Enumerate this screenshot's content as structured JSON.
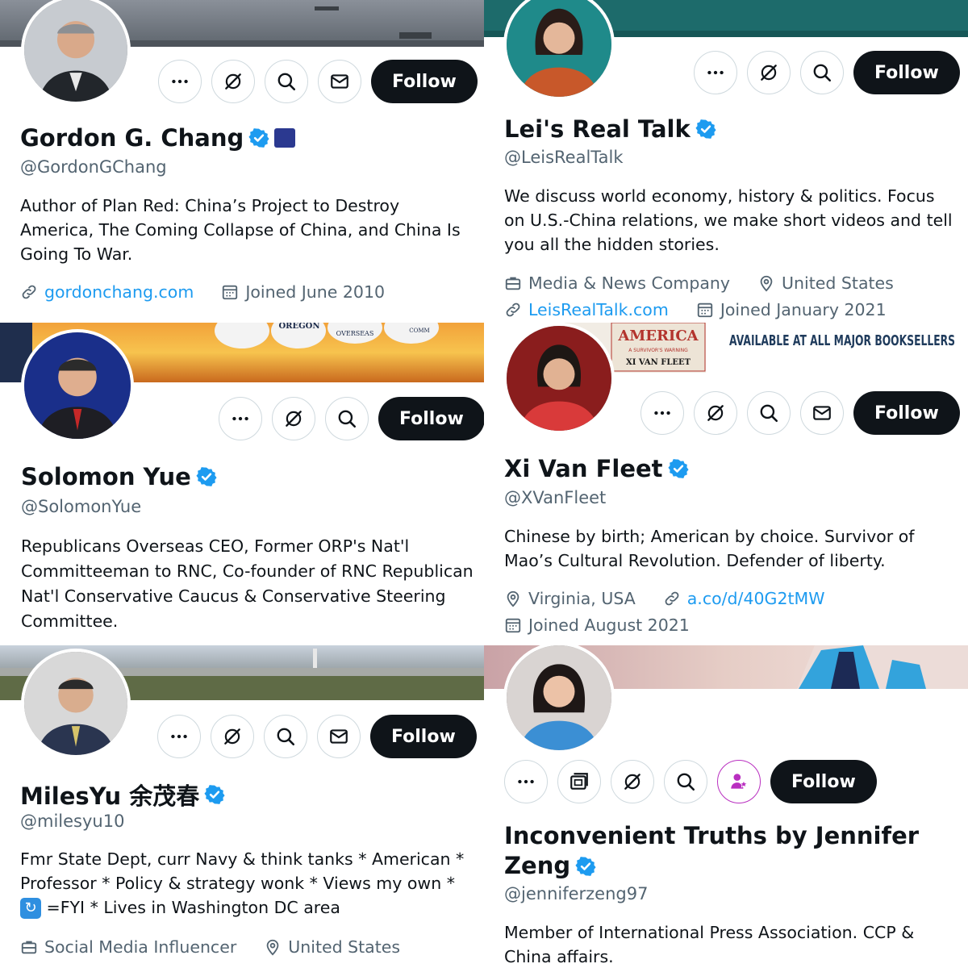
{
  "profiles": [
    {
      "name": "Gordon G. Chang",
      "handle": "@GordonGChang",
      "bio": "Author of Plan Red: China’s Project to Destroy America, The Coming Collapse of China, and China Is Going To War.",
      "website": "gordonchang.com",
      "joined": "Joined June 2010",
      "follow": "Follow"
    },
    {
      "name": "Lei's Real Talk",
      "handle": "@LeisRealTalk",
      "bio": "We discuss world economy, history & politics. Focus on U.S.-China relations, we make short videos and tell you all the hidden stories.",
      "category": "Media & News Company",
      "location": "United States",
      "website": "LeisRealTalk.com",
      "joined": "Joined January 2021",
      "follow": "Follow"
    },
    {
      "name": "Solomon Yue",
      "handle": "@SolomonYue",
      "bio": "Republicans Overseas CEO, Former ORP's Nat'l Committeeman to RNC, Co-founder of RNC Republican Nat'l Conservative Caucus & Conservative Steering Committee.",
      "banner_text": [
        "OREGON",
        "OVERSEAS",
        "COMM"
      ],
      "follow": "Follow"
    },
    {
      "name": "Xi Van Fleet",
      "handle": "@XVanFleet",
      "bio": "Chinese by birth; American by choice. Survivor of Mao’s Cultural Revolution. Defender of liberty.",
      "location": "Virginia, USA",
      "website": "a.co/d/40G2tMW",
      "joined": "Joined August 2021",
      "banner_text": "AVAILABLE AT ALL MAJOR BOOKSELLERS",
      "book_title": "AMERICA",
      "book_subtitle": "A SURVIVOR'S WARNING",
      "book_author": "XI VAN FLEET",
      "follow": "Follow"
    },
    {
      "name": "MilesYu 余茂春",
      "handle": "@milesyu10",
      "bio_1": "Fmr State Dept, curr Navy & think tanks * American * Professor * Policy & strategy wonk * Views my own *",
      "bio_2": "=FYI * Lives in Washington DC area",
      "category": "Social Media Influencer",
      "location": "United States",
      "follow": "Follow"
    },
    {
      "name_line1": "Inconvenient Truths by Jennifer",
      "name_line2": "Zeng",
      "handle": "@jenniferzeng97",
      "bio": "Member of International Press Association. CCP & China affairs.",
      "follow": "Follow"
    }
  ],
  "icons": {
    "more": "more-icon",
    "grok": "grok-icon",
    "search": "search-icon",
    "message": "message-icon",
    "verified": "verified-badge-icon",
    "link": "link-icon",
    "calendar": "calendar-icon",
    "briefcase": "briefcase-icon",
    "location": "location-icon",
    "subscriptions": "subscriptions-icon",
    "subscribe": "subscribe-icon"
  },
  "colors": {
    "follow_bg": "#0f1419",
    "verified": "#1d9bf0",
    "link": "#1d9bf0",
    "secondary_text": "#536471",
    "lei_banner": "#1d6b6b",
    "subscribe_accent": "#b92fc0"
  }
}
